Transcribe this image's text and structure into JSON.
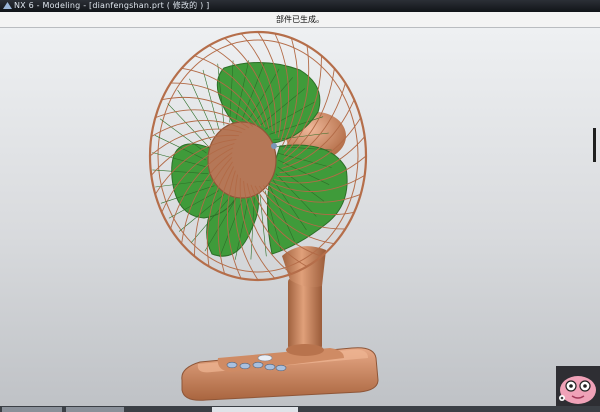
{
  "window": {
    "title": "NX 6 - Modeling - [dianfengshan.prt  ( 修改的 ) ]"
  },
  "status": {
    "message": "部件已生成。"
  },
  "model": {
    "colors": {
      "background_top": "#eef0f2",
      "background_bottom": "#bfc2c6",
      "blade": "#3f9b3a",
      "blade_edge": "#2d6e28",
      "copper": "#c98a63",
      "copper_dark": "#8e5638",
      "button": "#9fb7d6"
    }
  },
  "icons": {
    "app_logo": "nx-logo-icon",
    "mascot": "mascot-icon"
  }
}
